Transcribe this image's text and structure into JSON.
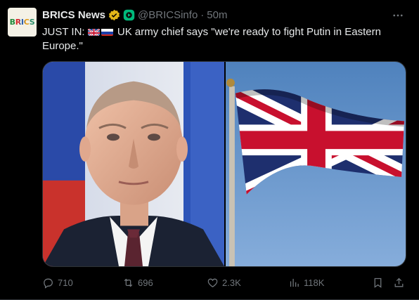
{
  "tweet": {
    "avatar_text": "BRICS",
    "display_name": "BRICS News",
    "handle": "@BRICSinfo",
    "separator": "·",
    "time": "50m",
    "text_prefix": "JUST IN:",
    "text_body": "UK army chief says \"we're ready to fight Putin in Eastern Europe.\"",
    "colors": {
      "verified_gold": "#e2b719",
      "affiliate_green": "#00ba7c",
      "muted": "#71767b",
      "text": "#e7e9ea"
    }
  },
  "actions": {
    "replies": "710",
    "retweets": "696",
    "likes": "2.3K",
    "views": "118K"
  },
  "icons": {
    "more": "more-dots-icon",
    "reply": "reply-icon",
    "retweet": "retweet-icon",
    "like": "heart-icon",
    "views": "views-bar-chart-icon",
    "bookmark": "bookmark-icon",
    "share": "share-icon"
  }
}
